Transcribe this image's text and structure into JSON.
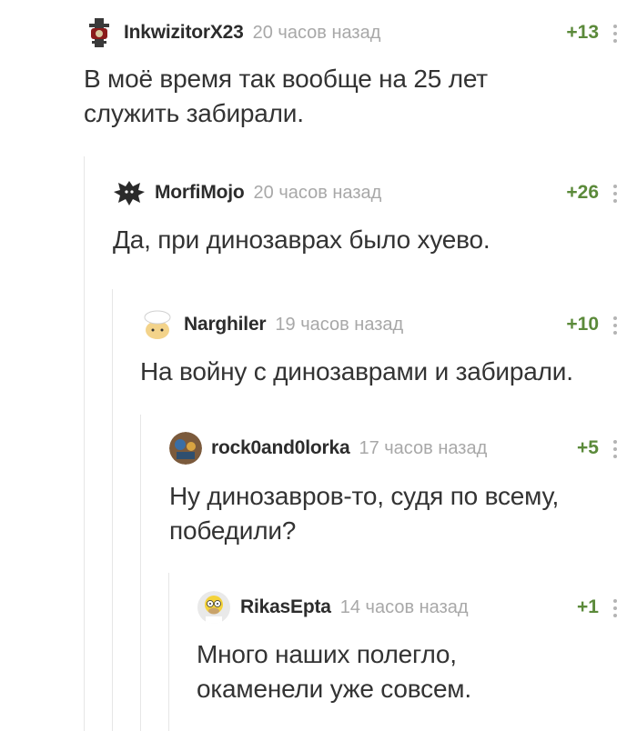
{
  "comments": [
    {
      "author": "InkwizitorX23",
      "time": "20 часов назад",
      "rating": "+13",
      "text": "В моё время так вообще на 25 лет\nслужить забирали.",
      "avatar_icon": "inquisition-emblem-icon"
    },
    {
      "author": "MorfiMojo",
      "time": "20 часов назад",
      "rating": "+26",
      "text": "Да, при динозаврах было хуево.",
      "avatar_icon": "wolf-emblem-icon"
    },
    {
      "author": "Narghiler",
      "time": "19 часов назад",
      "rating": "+10",
      "text": "На войну с динозаврами и забирали.",
      "avatar_icon": "cartoon-character-icon"
    },
    {
      "author": "rock0and0lorka",
      "time": "17 часов назад",
      "rating": "+5",
      "text": "Ну динозавров-то, судя по всему,\nпобедили?",
      "avatar_icon": "round-photo-avatar-icon"
    },
    {
      "author": "RikasEpta",
      "time": "14 часов назад",
      "rating": "+1",
      "text": "Много наших полегло,\nокаменели уже совсем.",
      "avatar_icon": "homer-avatar-icon"
    }
  ],
  "colors": {
    "rating": "#5b8a3a",
    "author": "#2c2c2c",
    "time": "#a8a8a8",
    "text": "#333333",
    "thread_line": "#e6e6e6"
  }
}
